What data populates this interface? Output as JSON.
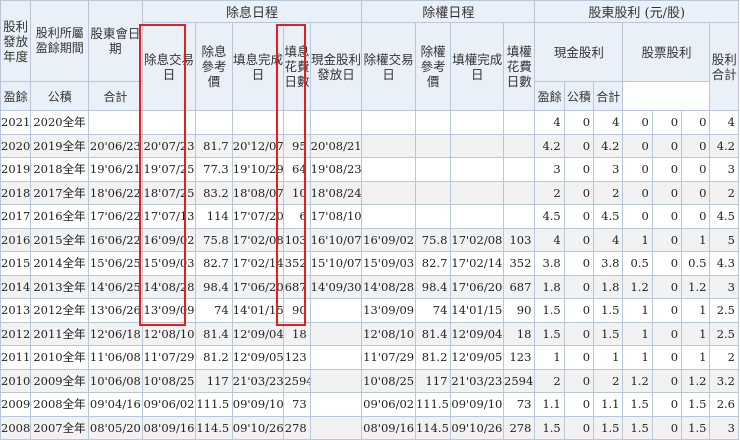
{
  "table": {
    "group_headers": {
      "ex_dividend_schedule": "除息日程",
      "ex_rights_schedule": "除權日程",
      "shareholder_dividend": "股東股利 (元/股)"
    },
    "headers": {
      "year": "股利發放年度",
      "period": "股利所屬盈餘期間",
      "meeting_date": "股東會日期",
      "ex_div_date": "除息交易日",
      "ex_div_ref_price": "除息參考價",
      "div_fill_date": "填息完成日",
      "div_fill_days": "填息花費日數",
      "cash_pay_date": "現金股利發放日",
      "ex_right_date": "除權交易日",
      "ex_right_ref_price": "除權參考價",
      "right_fill_date": "填權完成日",
      "right_fill_days": "填權花費日數",
      "cash_dividend": "現金股利",
      "stock_dividend": "股票股利",
      "total_dividend": "股利合計"
    },
    "sub_headers": {
      "earnings": "盈餘",
      "capital_reserve": "公積",
      "subtotal": "合計"
    },
    "rows": [
      {
        "year": "2021",
        "period": "2020全年",
        "meeting": "",
        "ex_div": "",
        "ex_div_ref": "",
        "div_fill": "",
        "div_days": "",
        "cash_pay": "",
        "ex_right": "",
        "ex_right_ref": "",
        "right_fill": "",
        "right_days": "",
        "cash_e": "4",
        "cash_c": "0",
        "cash_t": "4",
        "stock_e": "0",
        "stock_c": "0",
        "stock_t": "0",
        "total": "4"
      },
      {
        "year": "2020",
        "period": "2019全年",
        "meeting": "20'06/23",
        "ex_div": "20'07/23",
        "ex_div_ref": "81.7",
        "div_fill": "20'12/07",
        "div_days": "95",
        "cash_pay": "20'08/21",
        "ex_right": "",
        "ex_right_ref": "",
        "right_fill": "",
        "right_days": "",
        "cash_e": "4.2",
        "cash_c": "0",
        "cash_t": "4.2",
        "stock_e": "0",
        "stock_c": "0",
        "stock_t": "0",
        "total": "4.2"
      },
      {
        "year": "2019",
        "period": "2018全年",
        "meeting": "19'06/21",
        "ex_div": "19'07/25",
        "ex_div_ref": "77.3",
        "div_fill": "19'10/29",
        "div_days": "64",
        "cash_pay": "19'08/23",
        "ex_right": "",
        "ex_right_ref": "",
        "right_fill": "",
        "right_days": "",
        "cash_e": "3",
        "cash_c": "0",
        "cash_t": "3",
        "stock_e": "0",
        "stock_c": "0",
        "stock_t": "0",
        "total": "3"
      },
      {
        "year": "2018",
        "period": "2017全年",
        "meeting": "18'06/22",
        "ex_div": "18'07/25",
        "ex_div_ref": "83.2",
        "div_fill": "18'08/07",
        "div_days": "10",
        "cash_pay": "18'08/24",
        "ex_right": "",
        "ex_right_ref": "",
        "right_fill": "",
        "right_days": "",
        "cash_e": "2",
        "cash_c": "0",
        "cash_t": "2",
        "stock_e": "0",
        "stock_c": "0",
        "stock_t": "0",
        "total": "2"
      },
      {
        "year": "2017",
        "period": "2016全年",
        "meeting": "17'06/22",
        "ex_div": "17'07/13",
        "ex_div_ref": "114",
        "div_fill": "17'07/20",
        "div_days": "6",
        "cash_pay": "17'08/10",
        "ex_right": "",
        "ex_right_ref": "",
        "right_fill": "",
        "right_days": "",
        "cash_e": "4.5",
        "cash_c": "0",
        "cash_t": "4.5",
        "stock_e": "0",
        "stock_c": "0",
        "stock_t": "0",
        "total": "4.5"
      },
      {
        "year": "2016",
        "period": "2015全年",
        "meeting": "16'06/22",
        "ex_div": "16'09/02",
        "ex_div_ref": "75.8",
        "div_fill": "17'02/08",
        "div_days": "103",
        "cash_pay": "16'10/07",
        "ex_right": "16'09/02",
        "ex_right_ref": "75.8",
        "right_fill": "17'02/08",
        "right_days": "103",
        "cash_e": "4",
        "cash_c": "0",
        "cash_t": "4",
        "stock_e": "1",
        "stock_c": "0",
        "stock_t": "1",
        "total": "5"
      },
      {
        "year": "2015",
        "period": "2014全年",
        "meeting": "15'06/25",
        "ex_div": "15'09/03",
        "ex_div_ref": "82.7",
        "div_fill": "17'02/14",
        "div_days": "352",
        "cash_pay": "15'10/07",
        "ex_right": "15'09/03",
        "ex_right_ref": "82.7",
        "right_fill": "17'02/14",
        "right_days": "352",
        "cash_e": "3.8",
        "cash_c": "0",
        "cash_t": "3.8",
        "stock_e": "0.5",
        "stock_c": "0",
        "stock_t": "0.5",
        "total": "4.3"
      },
      {
        "year": "2014",
        "period": "2013全年",
        "meeting": "14'06/25",
        "ex_div": "14'08/28",
        "ex_div_ref": "98.4",
        "div_fill": "17'06/20",
        "div_days": "687",
        "cash_pay": "14'09/30",
        "ex_right": "14'08/28",
        "ex_right_ref": "98.4",
        "right_fill": "17'06/20",
        "right_days": "687",
        "cash_e": "1.8",
        "cash_c": "0",
        "cash_t": "1.8",
        "stock_e": "1.2",
        "stock_c": "0",
        "stock_t": "1.2",
        "total": "3"
      },
      {
        "year": "2013",
        "period": "2012全年",
        "meeting": "13'06/26",
        "ex_div": "13'09/09",
        "ex_div_ref": "74",
        "div_fill": "14'01/15",
        "div_days": "90",
        "cash_pay": "",
        "ex_right": "13'09/09",
        "ex_right_ref": "74",
        "right_fill": "14'01/15",
        "right_days": "90",
        "cash_e": "1.5",
        "cash_c": "0",
        "cash_t": "1.5",
        "stock_e": "1",
        "stock_c": "0",
        "stock_t": "1",
        "total": "2.5"
      },
      {
        "year": "2012",
        "period": "2011全年",
        "meeting": "12'06/18",
        "ex_div": "12'08/10",
        "ex_div_ref": "81.4",
        "div_fill": "12'09/04",
        "div_days": "18",
        "cash_pay": "",
        "ex_right": "12'08/10",
        "ex_right_ref": "81.4",
        "right_fill": "12'09/04",
        "right_days": "18",
        "cash_e": "1.5",
        "cash_c": "0",
        "cash_t": "1.5",
        "stock_e": "1",
        "stock_c": "0",
        "stock_t": "1",
        "total": "2.5"
      },
      {
        "year": "2011",
        "period": "2010全年",
        "meeting": "11'06/08",
        "ex_div": "11'07/29",
        "ex_div_ref": "81.2",
        "div_fill": "12'09/05",
        "div_days": "123",
        "cash_pay": "",
        "ex_right": "11'07/29",
        "ex_right_ref": "81.2",
        "right_fill": "12'09/05",
        "right_days": "123",
        "cash_e": "1",
        "cash_c": "0",
        "cash_t": "1",
        "stock_e": "1",
        "stock_c": "0",
        "stock_t": "1",
        "total": "2"
      },
      {
        "year": "2010",
        "period": "2009全年",
        "meeting": "10'06/08",
        "ex_div": "10'08/25",
        "ex_div_ref": "117",
        "div_fill": "21'03/23",
        "div_days": "2594",
        "cash_pay": "",
        "ex_right": "10'08/25",
        "ex_right_ref": "117",
        "right_fill": "21'03/23",
        "right_days": "2594",
        "cash_e": "2",
        "cash_c": "0",
        "cash_t": "2",
        "stock_e": "1.2",
        "stock_c": "0",
        "stock_t": "1.2",
        "total": "3.2"
      },
      {
        "year": "2009",
        "period": "2008全年",
        "meeting": "09'04/16",
        "ex_div": "09'06/02",
        "ex_div_ref": "111.5",
        "div_fill": "09'09/10",
        "div_days": "73",
        "cash_pay": "",
        "ex_right": "09'06/02",
        "ex_right_ref": "111.5",
        "right_fill": "09'09/10",
        "right_days": "73",
        "cash_e": "1.1",
        "cash_c": "0",
        "cash_t": "1.1",
        "stock_e": "1.5",
        "stock_c": "0",
        "stock_t": "1.5",
        "total": "2.6"
      },
      {
        "year": "2008",
        "period": "2007全年",
        "meeting": "08'05/20",
        "ex_div": "08'09/16",
        "ex_div_ref": "114.5",
        "div_fill": "09'10/26",
        "div_days": "278",
        "cash_pay": "",
        "ex_right": "08'09/16",
        "ex_right_ref": "114.5",
        "right_fill": "09'10/26",
        "right_days": "278",
        "cash_e": "1.5",
        "cash_c": "0",
        "cash_t": "1.5",
        "stock_e": "1.5",
        "stock_c": "0",
        "stock_t": "1.5",
        "total": "3"
      }
    ]
  },
  "highlight_color": "#e0201e"
}
